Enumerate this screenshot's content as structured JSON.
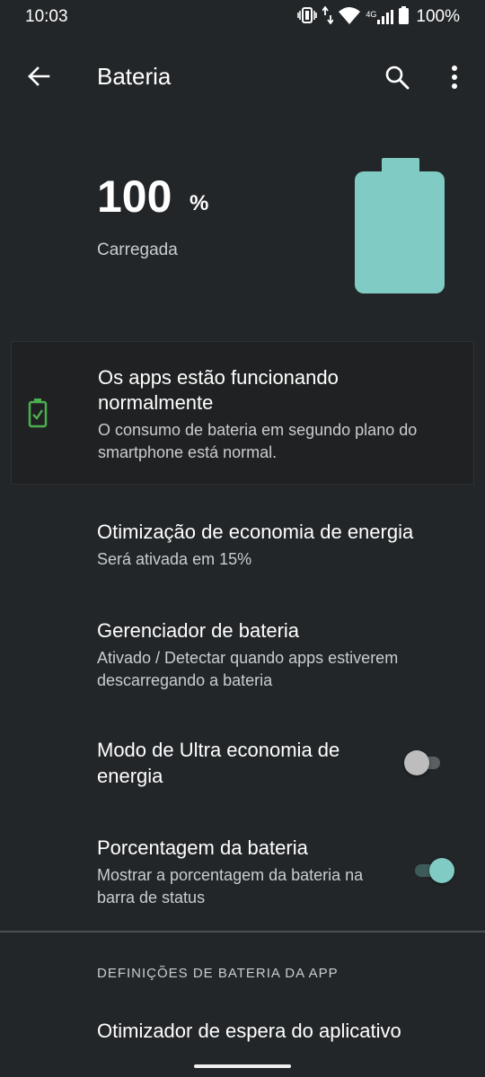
{
  "status_bar": {
    "time": "10:03",
    "battery_percent": "100%",
    "icons": [
      "vibrate-icon",
      "data-arrows-icon",
      "wifi-icon",
      "signal-4g-icon",
      "battery-icon"
    ],
    "network_label": "4G"
  },
  "app_bar": {
    "title": "Bateria",
    "back_icon": "arrow-back-icon",
    "search_icon": "search-icon",
    "more_icon": "more-vert-icon"
  },
  "battery": {
    "level": "100",
    "unit": "%",
    "state": "Carregada",
    "fill_fraction": 1.0,
    "color": "#80cbc4"
  },
  "status_card": {
    "title": "Os apps estão funcionando normalmente",
    "subtitle": "O consumo de bateria em segundo plano do smartphone está normal.",
    "icon": "battery-check-icon",
    "icon_color": "#4caf50"
  },
  "settings": [
    {
      "title": "Otimização de economia de energia",
      "subtitle": "Será ativada em 15%"
    },
    {
      "title": "Gerenciador de bateria",
      "subtitle": "Ativado / Detectar quando apps estiverem descarregando a bateria"
    },
    {
      "title": "Modo de Ultra economia de energia",
      "toggle": false
    },
    {
      "title": "Porcentagem da bateria",
      "subtitle": "Mostrar a porcentagem da bateria na barra de status",
      "toggle": true
    }
  ],
  "app_section": {
    "header": "DEFINIÇÕES DE BATERIA DA APP",
    "items": [
      {
        "title": "Otimizador de espera do aplicativo"
      }
    ]
  },
  "colors": {
    "background": "#222629",
    "accent": "#80cbc4",
    "card_background": "#202122"
  }
}
